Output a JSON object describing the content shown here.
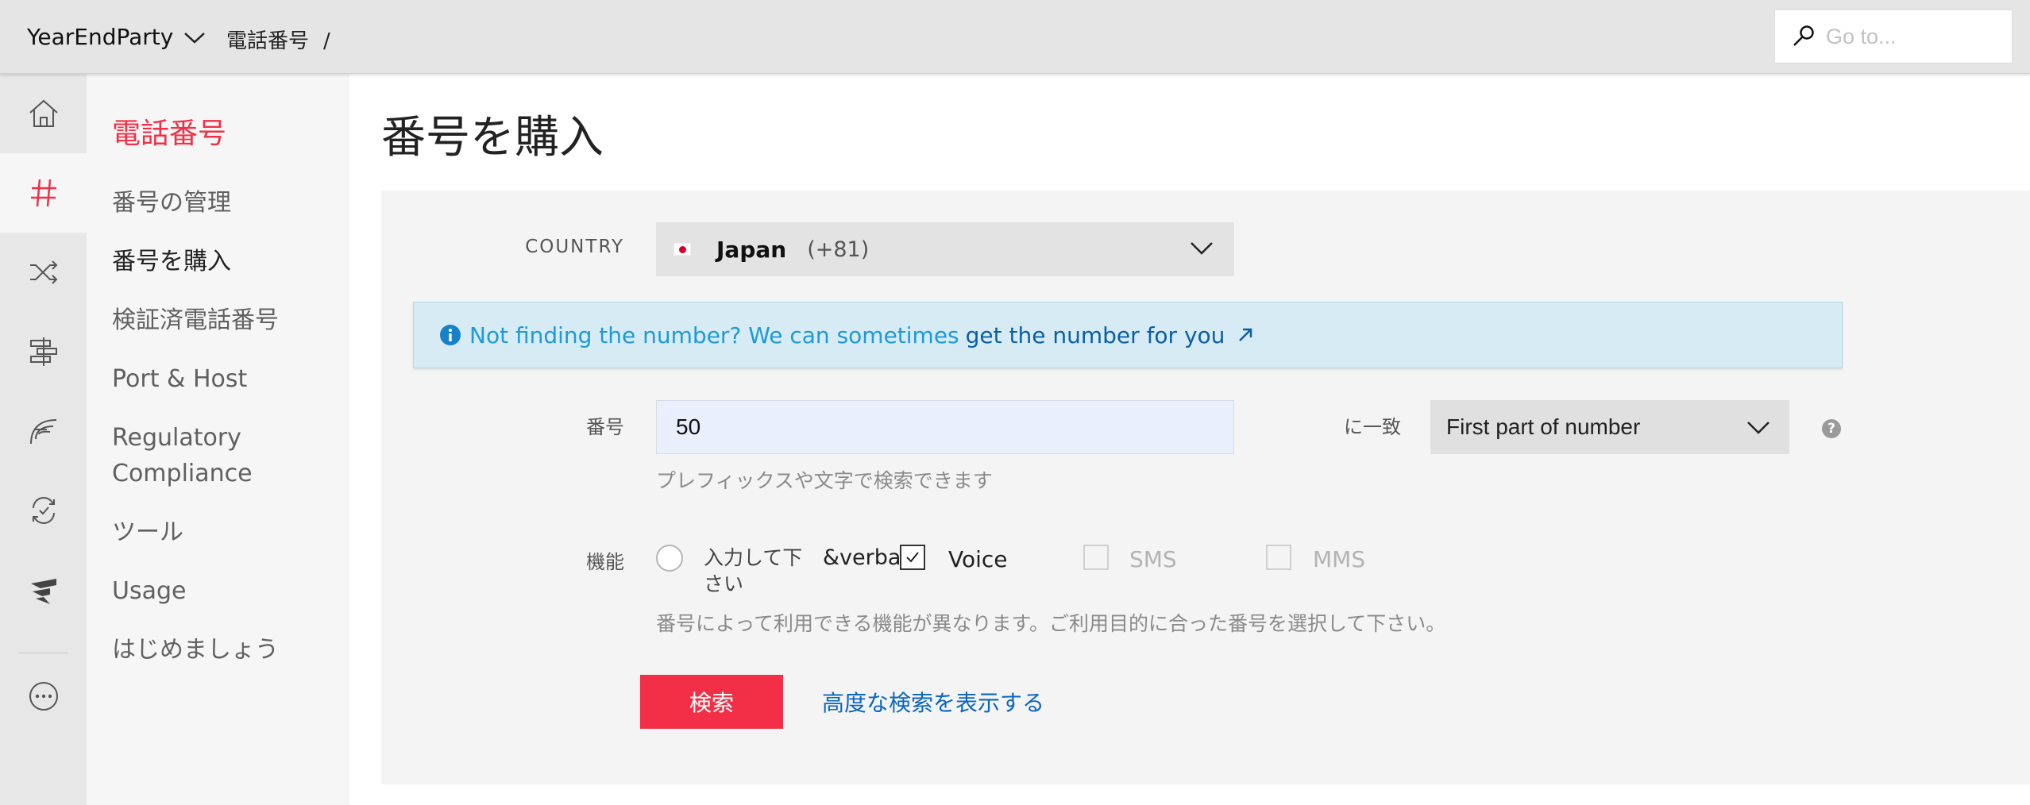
{
  "topbar": {
    "account_name": "YearEndParty",
    "breadcrumb": "電話番号",
    "breadcrumb_sep": "/",
    "goto_placeholder": "Go to..."
  },
  "rail": {
    "icons": [
      "home-icon",
      "hash-icon",
      "shuffle-icon",
      "stack-icon",
      "feather-icon",
      "sync-icon",
      "studio-icon",
      "more-icon"
    ],
    "active": "hash-icon",
    "accent_color": "#f22f46"
  },
  "sidebar": {
    "title": "電話番号",
    "items": [
      {
        "label": "番号の管理"
      },
      {
        "label": "番号を購入"
      },
      {
        "label": "検証済電話番号"
      },
      {
        "label": "Port & Host"
      },
      {
        "label": "Regulatory"
      },
      {
        "label": "Compliance"
      },
      {
        "label": "ツール"
      },
      {
        "label": "Usage"
      },
      {
        "label": "はじめましょう"
      }
    ],
    "active_item": "番号を購入"
  },
  "main": {
    "title": "番号を購入",
    "country": {
      "label": "COUNTRY",
      "name": "Japan",
      "code": "(+81)"
    },
    "info": {
      "text": "Not finding the number? We can sometimes",
      "link": "get the number for you"
    },
    "number": {
      "label": "番号",
      "value": "50",
      "hint": "プレフィックスや文字で検索できます"
    },
    "match": {
      "label": "に一致",
      "selected": "First part of number"
    },
    "capabilities": {
      "label": "機能",
      "radio_text_line1": "入力して下",
      "radio_text_line2": "さい",
      "stray_text": "&verbar;",
      "voice": "Voice",
      "sms": "SMS",
      "mms": "MMS",
      "voice_checked": true,
      "hint": "番号によって利用できる機能が異なります。ご利用目的に合った番号を選択して下さい。"
    },
    "search_button": "検索",
    "advanced_link": "高度な検索を表示する"
  }
}
